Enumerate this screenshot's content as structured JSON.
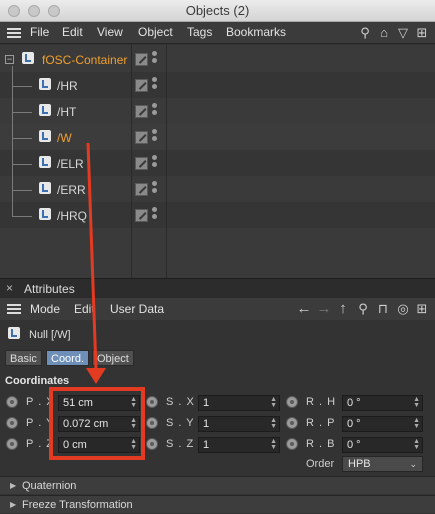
{
  "window": {
    "title": "Objects (2)"
  },
  "menu": {
    "items": [
      "File",
      "Edit",
      "View",
      "Object",
      "Tags",
      "Bookmarks"
    ]
  },
  "toolbar_icons": [
    "search-icon",
    "home-icon",
    "filter-icon",
    "new-window-icon"
  ],
  "objects": [
    {
      "name": "fOSC-Container",
      "highlight": true,
      "level": 0
    },
    {
      "name": "/HR",
      "highlight": false,
      "level": 1
    },
    {
      "name": "/HT",
      "highlight": false,
      "level": 1
    },
    {
      "name": "/W",
      "highlight": true,
      "level": 1
    },
    {
      "name": "/ELR",
      "highlight": false,
      "level": 1
    },
    {
      "name": "/ERR",
      "highlight": false,
      "level": 1
    },
    {
      "name": "/HRQ",
      "highlight": false,
      "level": 1
    }
  ],
  "attributes": {
    "title": "Attributes",
    "menu": [
      "Mode",
      "Edit",
      "User Data"
    ],
    "object_label": "Null [/W]",
    "tabs": [
      "Basic",
      "Coord.",
      "Object"
    ],
    "active_tab": "Coord.",
    "section": "Coordinates",
    "fields": {
      "position": [
        {
          "label": "P . X",
          "value": "51 cm"
        },
        {
          "label": "P . Y",
          "value": "0.072 cm"
        },
        {
          "label": "P . Z",
          "value": "0 cm"
        }
      ],
      "scale": [
        {
          "label": "S . X",
          "value": "1"
        },
        {
          "label": "S . Y",
          "value": "1"
        },
        {
          "label": "S . Z",
          "value": "1"
        }
      ],
      "rotation": [
        {
          "label": "R . H",
          "value": "0 °"
        },
        {
          "label": "R . P",
          "value": "0 °"
        },
        {
          "label": "R . B",
          "value": "0 °"
        }
      ]
    },
    "order_label": "Order",
    "order_value": "HPB",
    "collapsed_sections": [
      "Quaternion",
      "Freeze Transformation"
    ]
  },
  "colors": {
    "accent_orange": "#f0a030",
    "tab_active": "#6d8fb8",
    "annotation_red": "#e33b22"
  }
}
